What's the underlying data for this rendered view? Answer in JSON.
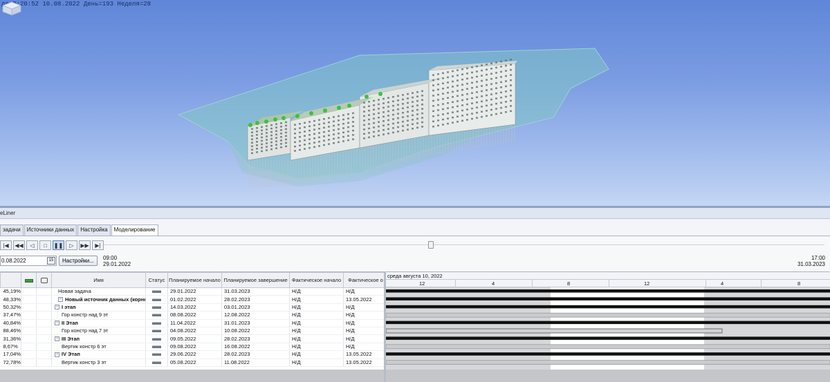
{
  "viewport": {
    "status_text": "да 0:20:52  10.08.2022  День=193  Неделя=28"
  },
  "panel": {
    "title": "eLiner",
    "tabs": [
      "задачи",
      "Источники данных",
      "Настройка",
      "Моделирование"
    ],
    "active_tab": 3,
    "current_date": "0.08.2022",
    "calendar_day": "15",
    "settings_label": "Настройки...",
    "range_start_time": "09:00",
    "range_start_date": "29.01.2022",
    "range_end_time": "17:00",
    "range_end_date": "31.03.2023",
    "slider_position": 0.45,
    "transport": [
      {
        "icon": "rewind-start-icon",
        "glyph": "|◀"
      },
      {
        "icon": "step-back-icon",
        "glyph": "◀◀"
      },
      {
        "icon": "play-reverse-icon",
        "glyph": "◁"
      },
      {
        "icon": "stop-icon",
        "glyph": "□"
      },
      {
        "icon": "pause-icon",
        "glyph": "❚❚"
      },
      {
        "icon": "play-icon",
        "glyph": "▷"
      },
      {
        "icon": "step-forward-icon",
        "glyph": "▶▶"
      },
      {
        "icon": "forward-end-icon",
        "glyph": "▶|"
      }
    ]
  },
  "grid": {
    "columns": [
      "",
      "",
      "Имя",
      "Статус",
      "Планируемое начало",
      "Планируемое завершение",
      "Фактическое начало",
      "Фактическое о"
    ],
    "rows": [
      {
        "pct": "45,19%",
        "name": "Новая задача",
        "indent": 0,
        "group": false,
        "expander": "",
        "plan_start": "29.01.2022",
        "plan_end": "31.03.2023",
        "fact_start": "Н/Д",
        "fact_end": "Н/Д"
      },
      {
        "pct": "48,33%",
        "name": "Новый источник данных (корневой)",
        "indent": 0,
        "group": true,
        "expander": "−",
        "plan_start": "01.02.2022",
        "plan_end": "28.02.2023",
        "fact_start": "Н/Д",
        "fact_end": "13.05.2022"
      },
      {
        "pct": "50,32%",
        "name": "I этап",
        "indent": 1,
        "group": true,
        "expander": "−",
        "plan_start": "14.03.2022",
        "plan_end": "03.01.2023",
        "fact_start": "Н/Д",
        "fact_end": "Н/Д"
      },
      {
        "pct": "37,47%",
        "name": "Гор констр над 9 эт",
        "indent": 2,
        "group": false,
        "expander": "",
        "plan_start": "08.08.2022",
        "plan_end": "12.08.2022",
        "fact_start": "Н/Д",
        "fact_end": "Н/Д"
      },
      {
        "pct": "40,84%",
        "name": "II Этап",
        "indent": 1,
        "group": true,
        "expander": "−",
        "plan_start": "11.04.2022",
        "plan_end": "31.01.2023",
        "fact_start": "Н/Д",
        "fact_end": "Н/Д"
      },
      {
        "pct": "88,46%",
        "name": "Гор констр над 7 эт",
        "indent": 2,
        "group": false,
        "expander": "",
        "plan_start": "04.08.2022",
        "plan_end": "10.08.2022",
        "fact_start": "Н/Д",
        "fact_end": "Н/Д"
      },
      {
        "pct": "31,36%",
        "name": "III Этап",
        "indent": 1,
        "group": true,
        "expander": "−",
        "plan_start": "09.05.2022",
        "plan_end": "28.02.2023",
        "fact_start": "Н/Д",
        "fact_end": "Н/Д"
      },
      {
        "pct": "8,67%",
        "name": "Вертик констр 6 эт",
        "indent": 2,
        "group": false,
        "expander": "",
        "plan_start": "09.08.2022",
        "plan_end": "16.08.2022",
        "fact_start": "Н/Д",
        "fact_end": "Н/Д"
      },
      {
        "pct": "17,04%",
        "name": "IV Этап",
        "indent": 1,
        "group": true,
        "expander": "−",
        "plan_start": "29.06.2022",
        "plan_end": "28.02.2023",
        "fact_start": "Н/Д",
        "fact_end": "13.05.2022"
      },
      {
        "pct": "72,78%",
        "name": "Вертик констр 3 эт",
        "indent": 2,
        "group": false,
        "expander": "",
        "plan_start": "05.08.2022",
        "plan_end": "11.08.2022",
        "fact_start": "Н/Д",
        "fact_end": "13.05.2022"
      }
    ]
  },
  "gantt": {
    "header_date": "среда августа 10, 2022",
    "ticks": [
      "12",
      "4",
      "8",
      "12",
      "4",
      "8"
    ]
  }
}
